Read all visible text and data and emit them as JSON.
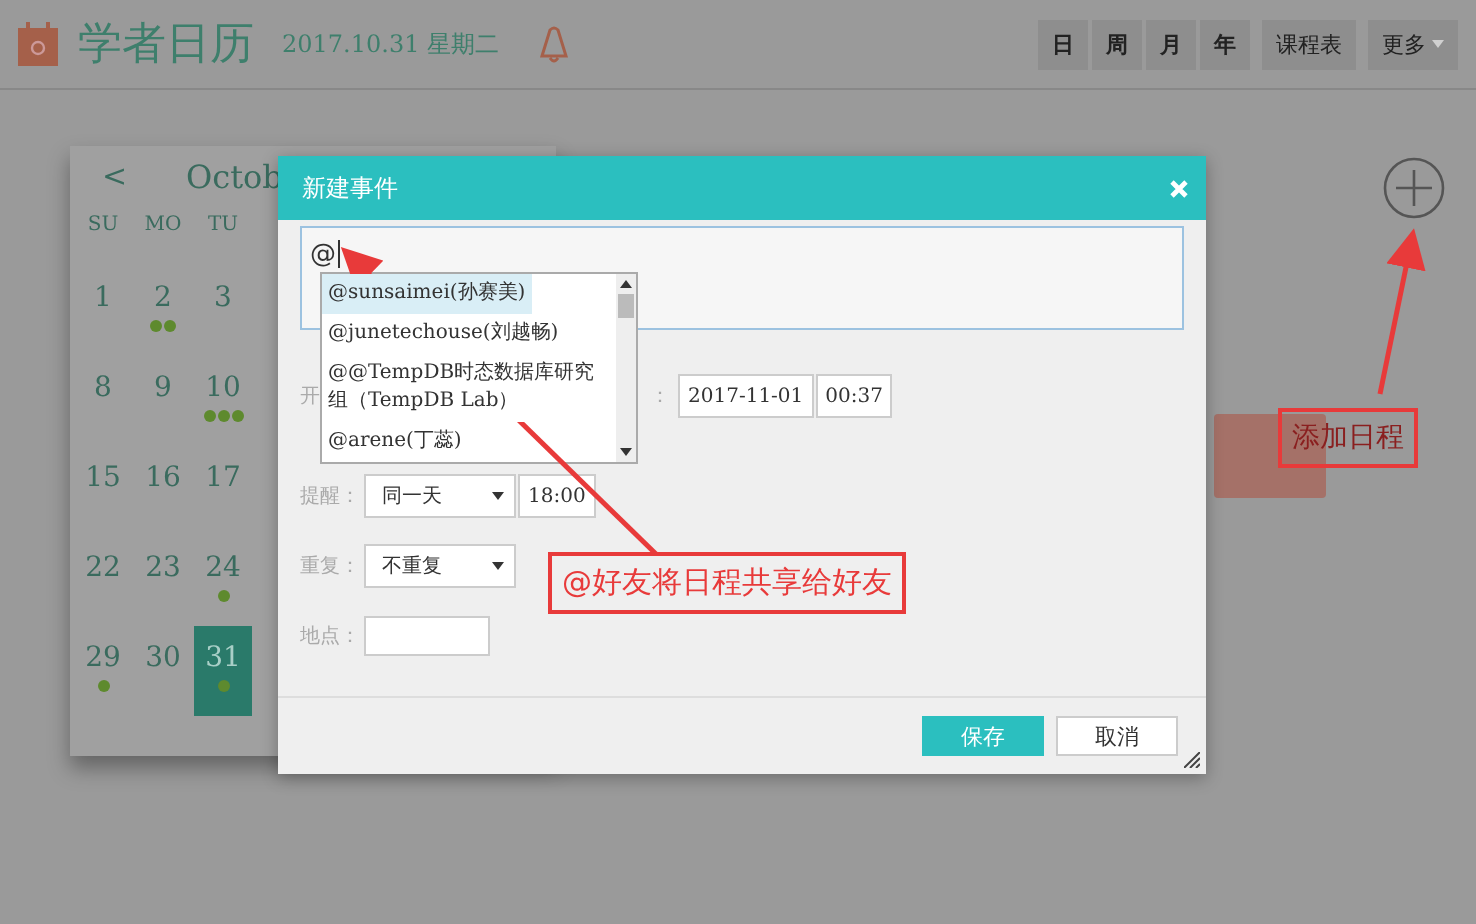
{
  "header": {
    "title": "学者日历",
    "date": "2017.10.31 星期二",
    "view_buttons": [
      {
        "label": "日",
        "kind": "plain"
      },
      {
        "label": "周",
        "kind": "plain"
      },
      {
        "label": "月",
        "kind": "plain"
      },
      {
        "label": "年",
        "kind": "plain"
      },
      {
        "label": "课程表",
        "kind": "plain"
      },
      {
        "label": "更多",
        "kind": "menu"
      }
    ]
  },
  "calendar": {
    "prev": "<",
    "month": "Octob",
    "weekdays": [
      "SU",
      "MO",
      "TU"
    ],
    "weeks": [
      [
        {
          "day": "1",
          "selected": false
        },
        {
          "day": "2",
          "selected": false,
          "dots": [
            {
              "color": "#5e8a2e"
            },
            {
              "color": "#5e8a2e"
            }
          ]
        },
        {
          "day": "3",
          "selected": false
        }
      ],
      [
        {
          "day": "8",
          "selected": false
        },
        {
          "day": "9",
          "selected": false
        },
        {
          "day": "10",
          "selected": false,
          "dots": [
            {
              "color": "#5e8a2e"
            },
            {
              "color": "#5e8a2e"
            },
            {
              "color": "#5e8a2e"
            }
          ]
        }
      ],
      [
        {
          "day": "15",
          "selected": false
        },
        {
          "day": "16",
          "selected": false
        },
        {
          "day": "17",
          "selected": false
        }
      ],
      [
        {
          "day": "22",
          "selected": false
        },
        {
          "day": "23",
          "selected": false
        },
        {
          "day": "24",
          "selected": false,
          "dots": [
            {
              "color": "#5e8a2e"
            }
          ]
        }
      ],
      [
        {
          "day": "29",
          "selected": false,
          "dots": [
            {
              "color": "#5e8a2e"
            }
          ]
        },
        {
          "day": "30",
          "selected": false
        },
        {
          "day": "31",
          "selected": true,
          "dots": [
            {
              "color": "#5e8a2e"
            }
          ]
        }
      ]
    ]
  },
  "dialog": {
    "title": "新建事件",
    "input_value": "@",
    "suggestions": [
      {
        "label": "@sunsaimei(孙赛美)",
        "selected": true
      },
      {
        "label": "@junetechouse(刘越畅)",
        "selected": false
      },
      {
        "label": "@@TempDB时态数据库研究组（TempDB Lab）",
        "selected": false
      },
      {
        "label": "@arene(丁蕊)",
        "selected": false
      }
    ],
    "start_label": "开",
    "end_colon": "：",
    "end_date": "2017-11-01",
    "end_time": "00:37",
    "reminder": {
      "label": "提醒：",
      "value": "同一天",
      "time": "18:00"
    },
    "repeat": {
      "label": "重复：",
      "value": "不重复"
    },
    "location": {
      "label": "地点："
    },
    "buttons": [
      {
        "label": "保存",
        "kind": "primary"
      },
      {
        "label": "取消",
        "kind": "secondary"
      }
    ]
  },
  "annotations": [
    {
      "text": "@好友将日程共享给好友"
    },
    {
      "text": "添加日程"
    }
  ]
}
